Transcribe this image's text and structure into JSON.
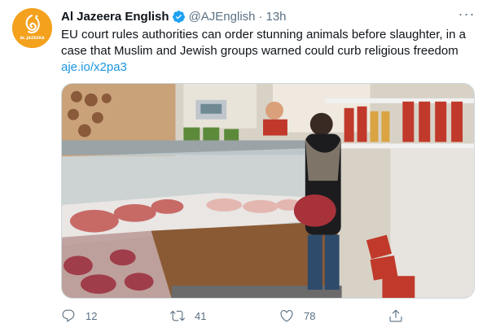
{
  "tweet": {
    "author_name": "Al Jazeera English",
    "handle": "@AJEnglish",
    "separator": "·",
    "time": "13h",
    "verified": true,
    "avatar_text": "AL JAZEERA",
    "text": "EU court rules authorities can order stunning animals before slaughter, in a case that Muslim and Jewish groups warned could curb religious freedom",
    "link": "aje.io/x2pa3",
    "more_label": "···"
  },
  "actions": {
    "reply_count": "12",
    "retweet_count": "41",
    "like_count": "78"
  },
  "icons": {
    "reply": "reply-icon",
    "retweet": "retweet-icon",
    "like": "heart-icon",
    "share": "share-icon",
    "verified": "verified-badge-icon",
    "more": "more-icon"
  },
  "colors": {
    "brand_avatar": "#f4a11d",
    "link": "#1b95e0",
    "verified": "#1da1f2",
    "secondary_text": "#5b7083"
  }
}
